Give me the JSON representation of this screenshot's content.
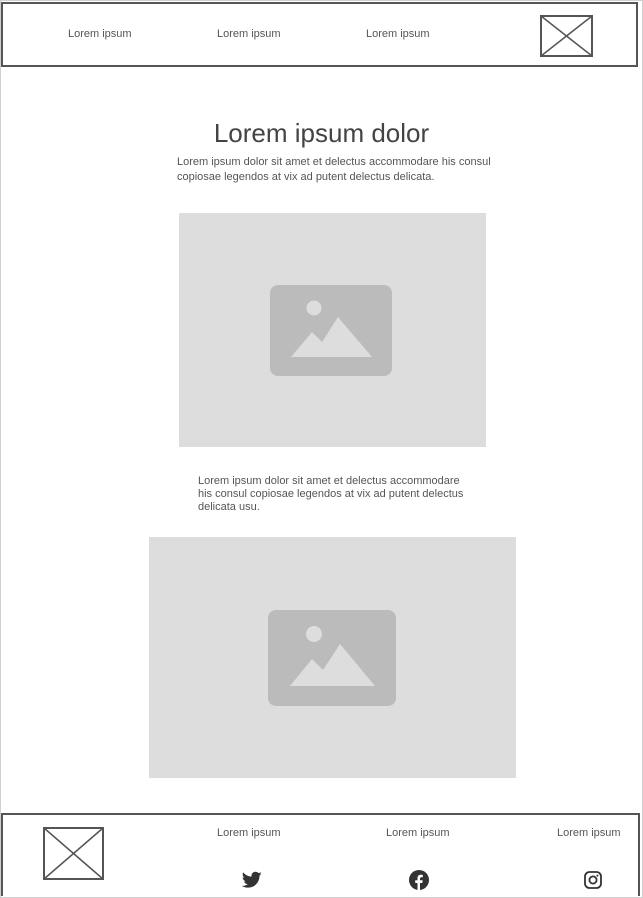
{
  "header": {
    "nav": [
      "Lorem ipsum",
      "Lorem ipsum",
      "Lorem ipsum"
    ]
  },
  "main": {
    "title": "Lorem ipsum dolor",
    "intro": "Lorem ipsum dolor sit amet et delectus accommodare his consul copiosae legendos at vix ad putent delectus delicata.",
    "body_text": "Lorem ipsum dolor sit amet et delectus accommodare his consul copiosae legendos at vix ad putent delectus delicata usu.",
    "images": [
      "image-placeholder-icon",
      "image-placeholder-icon"
    ]
  },
  "footer": {
    "links": [
      "Lorem ipsum",
      "Lorem ipsum",
      "Lorem ipsum"
    ],
    "social": [
      "twitter-icon",
      "facebook-icon",
      "instagram-icon"
    ]
  },
  "colors": {
    "stroke": "#555555",
    "placeholder_bg": "#dddddd",
    "placeholder_icon": "#bbbbbb"
  }
}
